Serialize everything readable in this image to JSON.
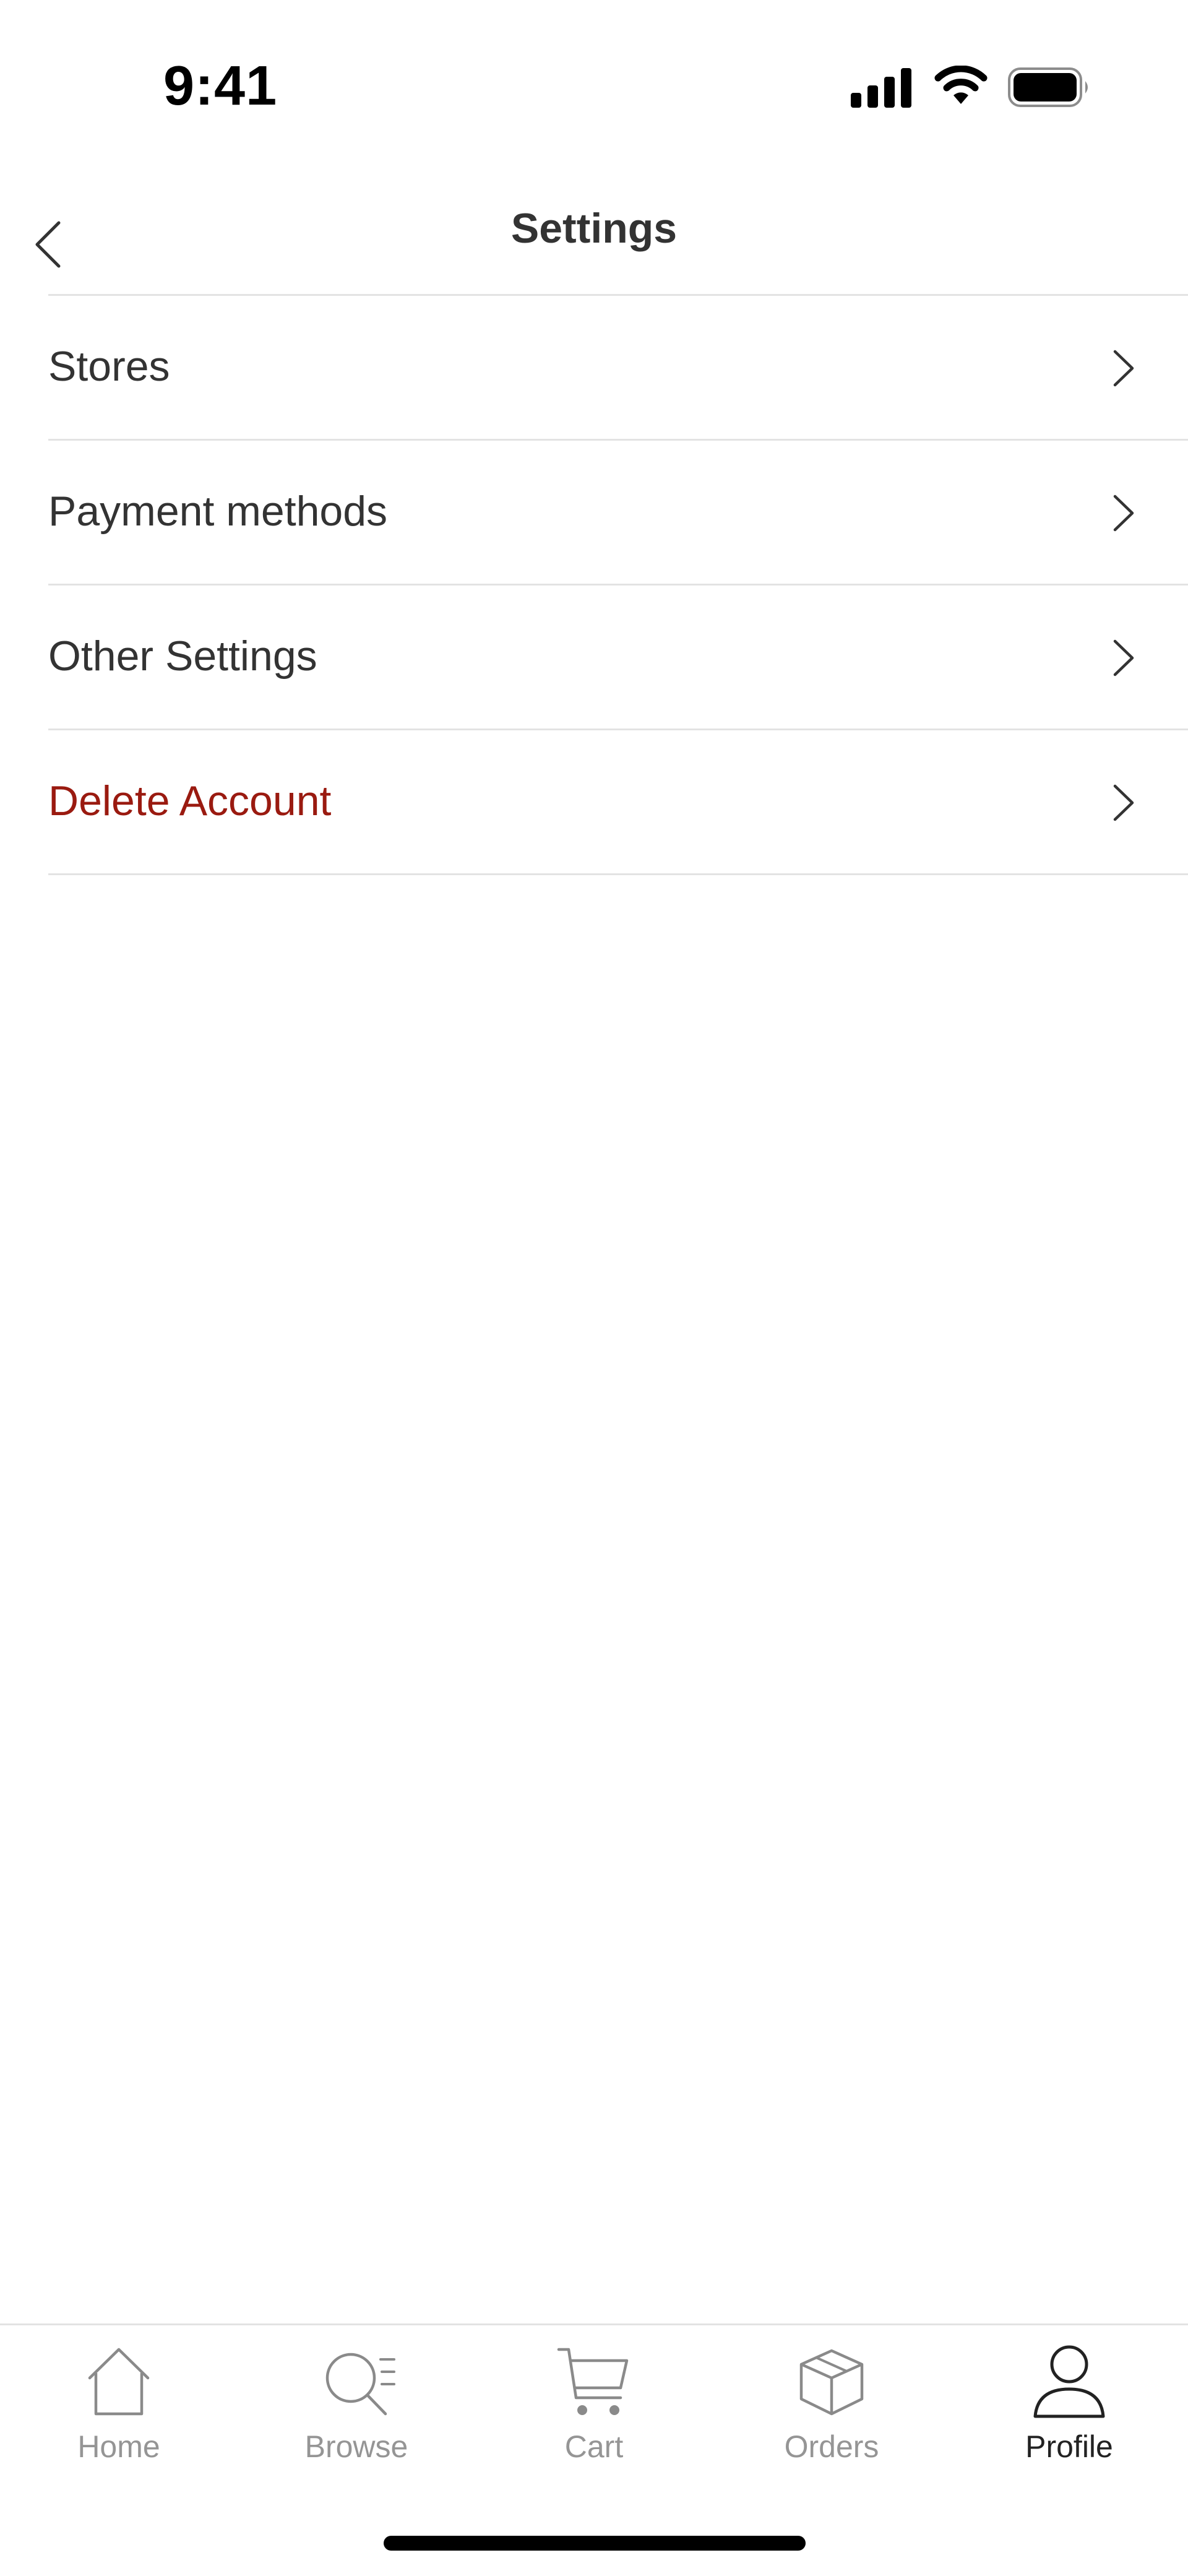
{
  "status_bar": {
    "time": "9:41",
    "icons": [
      "cellular-signal-icon",
      "wifi-icon",
      "battery-icon"
    ]
  },
  "nav": {
    "title": "Settings",
    "back_icon": "chevron-left-icon"
  },
  "settings": {
    "items": [
      {
        "label": "Stores",
        "style": "normal",
        "icon": "chevron-right-icon"
      },
      {
        "label": "Payment methods",
        "style": "normal",
        "icon": "chevron-right-icon"
      },
      {
        "label": "Other Settings",
        "style": "normal",
        "icon": "chevron-right-icon"
      },
      {
        "label": "Delete Account",
        "style": "danger",
        "icon": "chevron-right-icon"
      }
    ]
  },
  "tab_bar": {
    "tabs": [
      {
        "label": "Home",
        "icon": "home-icon",
        "active": false
      },
      {
        "label": "Browse",
        "icon": "browse-search-icon",
        "active": false
      },
      {
        "label": "Cart",
        "icon": "cart-icon",
        "active": false
      },
      {
        "label": "Orders",
        "icon": "box-icon",
        "active": false
      },
      {
        "label": "Profile",
        "icon": "person-icon",
        "active": true
      }
    ]
  },
  "colors": {
    "text_primary": "#333333",
    "danger": "#9a1a10",
    "tab_inactive": "#959595",
    "tab_active": "#222222",
    "divider": "#e3e3e3"
  }
}
